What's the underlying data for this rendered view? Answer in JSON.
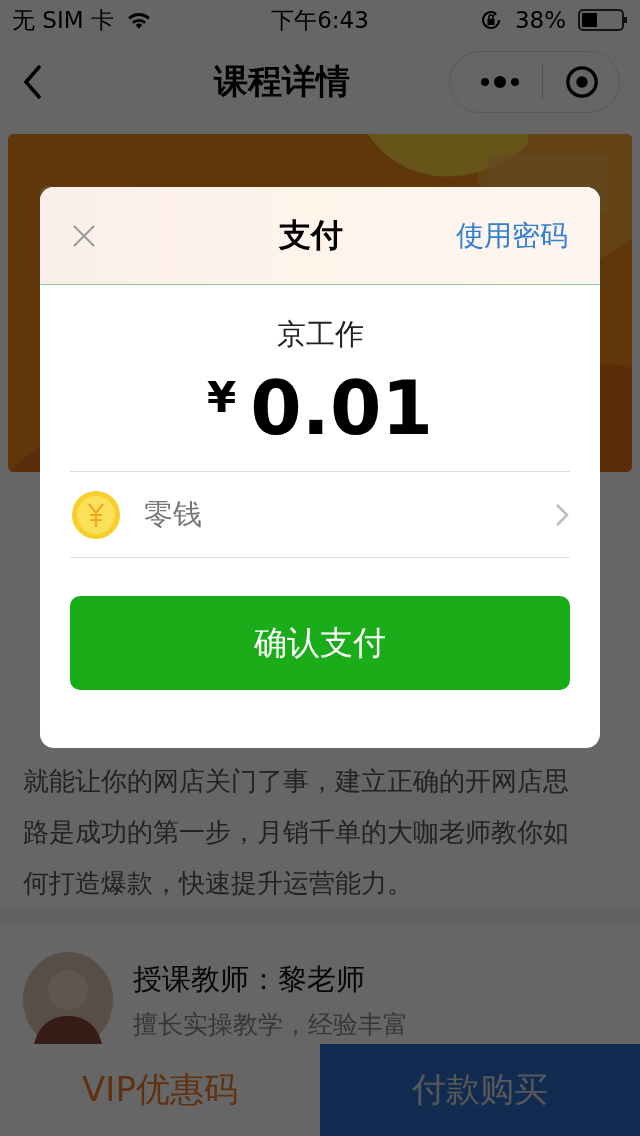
{
  "status_bar": {
    "carrier": "无 SIM 卡",
    "time": "下午6:43",
    "battery": "38%"
  },
  "nav": {
    "title": "课程详情"
  },
  "content": {
    "lines": [
      "就能让你的网店关门了事，建立正确的开网店思",
      "路是成功的第一步，月销千单的大咖老师教你如",
      "何打造爆款，快速提升运营能力。"
    ]
  },
  "teacher": {
    "name": "授课教师：黎老师",
    "bio": "擅长实操教学，经验丰富"
  },
  "bottom_bar": {
    "coupon": "VIP优惠码",
    "buy": "付款购买"
  },
  "payment": {
    "title": "支付",
    "alt_action": "使用密码",
    "merchant": "京工作",
    "currency": "¥",
    "amount": "0.01",
    "method": "零钱",
    "confirm": "确认支付"
  }
}
